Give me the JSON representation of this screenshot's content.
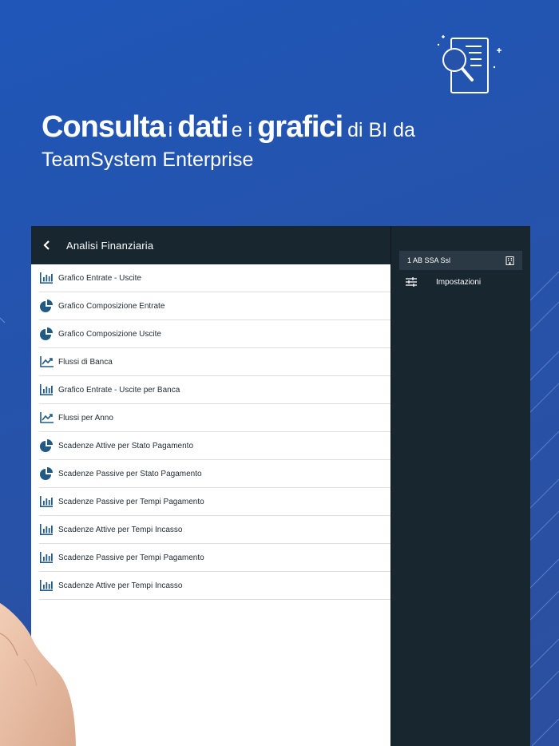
{
  "hero": {
    "word_consulta": "Consulta",
    "word_i1": "i",
    "word_dati": "dati",
    "word_e_i": "e i",
    "word_grafici": "grafici",
    "word_di_bi_da": "di BI da",
    "subtitle": "TeamSystem Enterprise"
  },
  "app": {
    "header_title": "Analisi Finanziaria",
    "list_items": [
      {
        "label": "Grafico Entrate - Uscite",
        "icon": "bar-chart-icon"
      },
      {
        "label": "Grafico Composizione Entrate",
        "icon": "pie-chart-icon"
      },
      {
        "label": "Grafico Composizione Uscite",
        "icon": "pie-chart-icon"
      },
      {
        "label": "Flussi di Banca",
        "icon": "trend-line-icon"
      },
      {
        "label": "Grafico Entrate - Uscite per Banca",
        "icon": "bar-chart-icon"
      },
      {
        "label": "Flussi per Anno",
        "icon": "trend-line-icon"
      },
      {
        "label": "Scadenze Attive per Stato Pagamento",
        "icon": "pie-chart-icon"
      },
      {
        "label": "Scadenze Passive per Stato Pagamento",
        "icon": "pie-chart-icon"
      },
      {
        "label": "Scadenze Passive per Tempi Pagamento",
        "icon": "bar-chart-icon"
      },
      {
        "label": "Scadenze Attive per Tempi Incasso",
        "icon": "bar-chart-icon"
      },
      {
        "label": "Scadenze Passive per Tempi Pagamento",
        "icon": "bar-chart-icon"
      },
      {
        "label": "Scadenze Attive per Tempi Incasso",
        "icon": "bar-chart-icon"
      }
    ],
    "side": {
      "company": "1 AB SSA Ssl",
      "settings_label": "Impostazioni"
    }
  },
  "colors": {
    "background": "#2752a8",
    "header_dark": "#17262f",
    "icon_blue": "#215a86"
  }
}
